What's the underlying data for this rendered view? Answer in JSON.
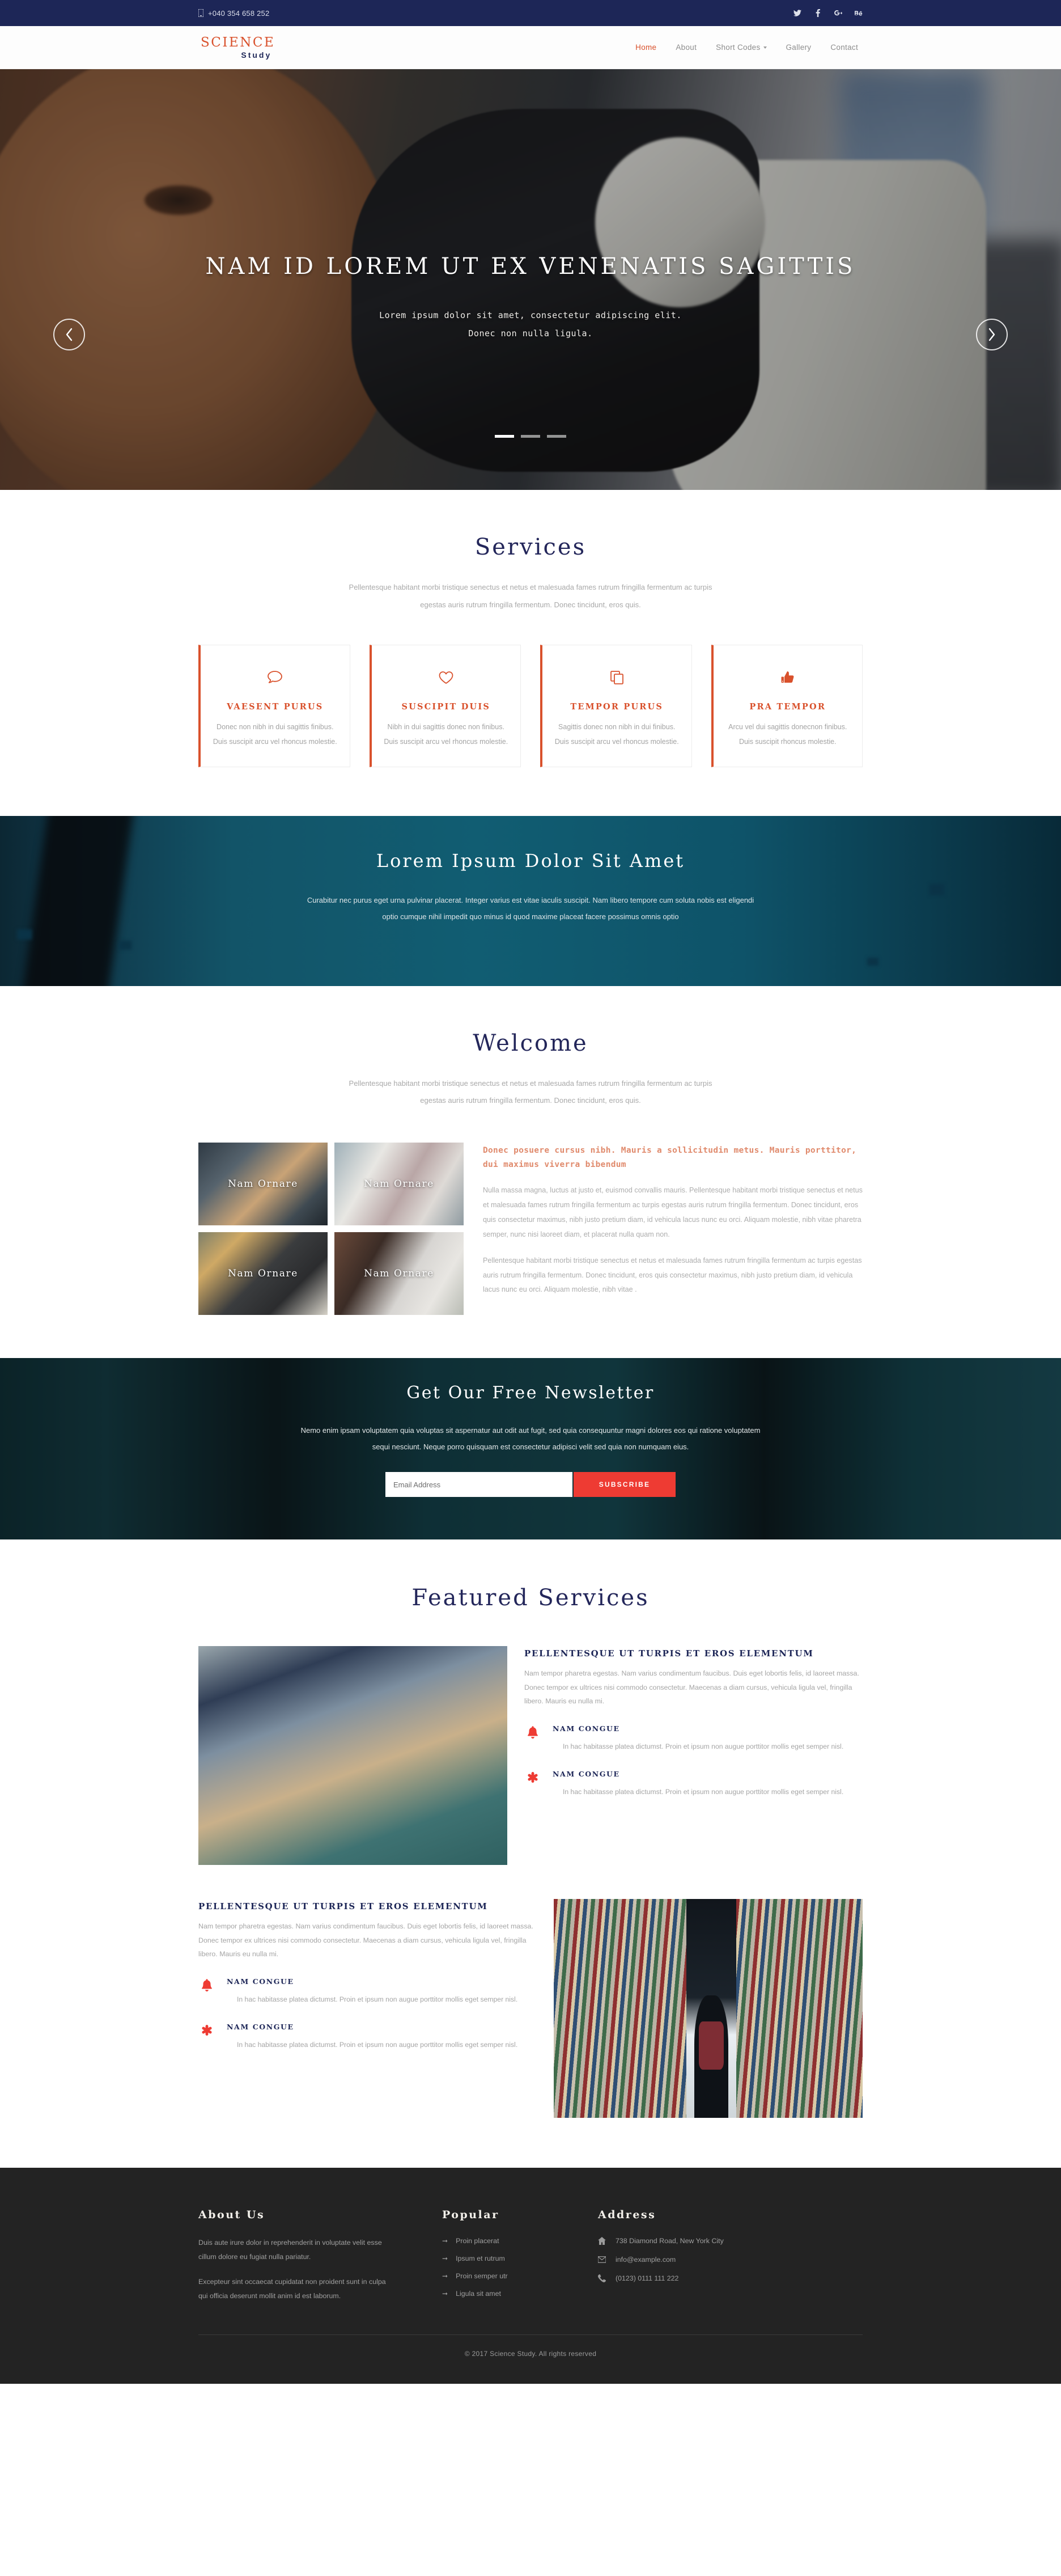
{
  "topbar": {
    "phone": "+040 354 658 252",
    "phone_icon": "phone-icon",
    "social": [
      {
        "name": "twitter-icon",
        "glyph": "t"
      },
      {
        "name": "facebook-icon",
        "glyph": "f"
      },
      {
        "name": "google-plus-icon",
        "glyph": "G+"
      },
      {
        "name": "behance-icon",
        "glyph": "Be"
      }
    ]
  },
  "header": {
    "logo_top": "SCIENCE",
    "logo_sub": "Study",
    "nav": [
      {
        "label": "Home",
        "active": true,
        "dropdown": false
      },
      {
        "label": "About",
        "active": false,
        "dropdown": false
      },
      {
        "label": "Short Codes",
        "active": false,
        "dropdown": true
      },
      {
        "label": "Gallery",
        "active": false,
        "dropdown": false
      },
      {
        "label": "Contact",
        "active": false,
        "dropdown": false
      }
    ]
  },
  "hero": {
    "title": "NAM ID LOREM UT EX VENENATIS SAGITTIS",
    "subtitle": "Lorem ipsum dolor sit amet, consectetur adipiscing elit. Donec non nulla ligula.",
    "prev_label": "‹",
    "next_label": "›",
    "slides": 3,
    "active_slide": 1
  },
  "services": {
    "title": "Services",
    "lead": "Pellentesque habitant morbi tristique senectus et netus et malesuada fames rutrum fringilla fermentum ac turpis egestas auris rutrum fringilla fermentum. Donec tincidunt, eros quis.",
    "cards": [
      {
        "icon": "comment-icon",
        "title": "VAESENT PURUS",
        "text": "Donec non nibh in dui sagittis finibus. Duis suscipit arcu vel rhoncus molestie."
      },
      {
        "icon": "heart-icon",
        "title": "SUSCIPIT DUIS",
        "text": "Nibh in dui sagittis donec non finibus. Duis suscipit arcu vel rhoncus molestie."
      },
      {
        "icon": "copy-icon",
        "title": "TEMPOR PURUS",
        "text": "Sagittis donec non nibh in dui finibus. Duis suscipit arcu vel rhoncus molestie."
      },
      {
        "icon": "thumbs-up-icon",
        "title": "PRA TEMPOR",
        "text": "Arcu vel dui sagittis donecnon finibus. Duis suscipit rhoncus molestie."
      }
    ]
  },
  "banner": {
    "title": "Lorem Ipsum Dolor Sit Amet",
    "text": "Curabitur nec purus eget urna pulvinar placerat. Integer varius est vitae iaculis suscipit. Nam libero tempore cum soluta nobis est eligendi optio cumque nihil impedit quo minus id quod maxime placeat facere possimus omnis optio"
  },
  "welcome": {
    "title": "Welcome",
    "lead": "Pellentesque habitant morbi tristique senectus et netus et malesuada fames rutrum fringilla fermentum ac turpis egestas auris rutrum fringilla fermentum. Donec tincidunt, eros quis.",
    "gallery": [
      {
        "label": "Nam Ornare"
      },
      {
        "label": "Nam Ornare"
      },
      {
        "label": "Nam Ornare"
      },
      {
        "label": "Nam Ornare"
      }
    ],
    "heading": "Donec posuere cursus nibh. Mauris a sollicitudin metus. Mauris porttitor, dui maximus viverra bibendum",
    "para1": "Nulla massa magna, luctus at justo et, euismod convallis mauris. Pellentesque habitant morbi tristique senectus et netus et malesuada fames rutrum fringilla fermentum ac turpis egestas auris rutrum fringilla fermentum. Donec tincidunt, eros quis consectetur maximus, nibh justo pretium diam, id vehicula lacus nunc eu orci. Aliquam molestie, nibh vitae pharetra semper, nunc nisi laoreet diam, et placerat nulla quam non.",
    "para2": "Pellentesque habitant morbi tristique senectus et netus et malesuada fames rutrum fringilla fermentum ac turpis egestas auris rutrum fringilla fermentum. Donec tincidunt, eros quis consectetur maximus, nibh justo pretium diam, id vehicula lacus nunc eu orci. Aliquam molestie, nibh vitae ."
  },
  "newsletter": {
    "title": "Get Our Free Newsletter",
    "text": "Nemo enim ipsam voluptatem quia voluptas sit aspernatur aut odit aut fugit, sed quia consequuntur magni dolores eos qui ratione voluptatem sequi nesciunt. Neque porro quisquam est consectetur adipisci velit sed quia non numquam eius.",
    "input_placeholder": "Email Address",
    "input_value": "",
    "button": "SUBSCRIBE"
  },
  "featured": {
    "title": "Featured Services",
    "blocks": [
      {
        "heading": "PELLENTESQUE UT TURPIS ET EROS ELEMENTUM",
        "text": "Nam tempor pharetra egestas. Nam varius condimentum faucibus. Duis eget lobortis felis, id laoreet massa. Donec tempor ex ultrices nisi commodo consectetur. Maecenas a diam cursus, vehicula ligula vel, fringilla libero. Mauris eu nulla mi.",
        "image": "students-on-couch-photo",
        "items": [
          {
            "icon": "bell-icon",
            "title": "NAM CONGUE",
            "text": "In hac habitasse platea dictumst. Proin et ipsum non augue porttitor mollis eget semper nisl."
          },
          {
            "icon": "asterisk-icon",
            "title": "NAM CONGUE",
            "text": "In hac habitasse platea dictumst. Proin et ipsum non augue porttitor mollis eget semper nisl."
          }
        ]
      },
      {
        "heading": "PELLENTESQUE UT TURPIS ET EROS ELEMENTUM",
        "text": "Nam tempor pharetra egestas. Nam varius condimentum faucibus. Duis eget lobortis felis, id laoreet massa. Donec tempor ex ultrices nisi commodo consectetur. Maecenas a diam cursus, vehicula ligula vel, fringilla libero. Mauris eu nulla mi.",
        "image": "library-aisle-photo",
        "items": [
          {
            "icon": "bell-icon",
            "title": "NAM CONGUE",
            "text": "In hac habitasse platea dictumst. Proin et ipsum non augue porttitor mollis eget semper nisl."
          },
          {
            "icon": "asterisk-icon",
            "title": "NAM CONGUE",
            "text": "In hac habitasse platea dictumst. Proin et ipsum non augue porttitor mollis eget semper nisl."
          }
        ]
      }
    ]
  },
  "footer": {
    "about": {
      "title": "About Us",
      "para1": "Duis aute irure dolor in reprehenderit in voluptate velit esse cillum dolore eu fugiat nulla pariatur.",
      "para2": "Excepteur sint occaecat cupidatat non proident sunt in culpa qui officia deserunt mollit anim id est laborum."
    },
    "popular": {
      "title": "Popular",
      "links": [
        "Proin placerat",
        "Ipsum et rutrum",
        "Proin semper utr",
        "Ligula sit amet"
      ]
    },
    "address": {
      "title": "Address",
      "items": [
        {
          "icon": "home-icon",
          "text": "738 Diamond Road, New York City"
        },
        {
          "icon": "envelope-icon",
          "text": "info@example.com"
        },
        {
          "icon": "phone-icon",
          "text": "(0123) 0111 111 222"
        }
      ]
    },
    "copyright": "© 2017 Science Study. All rights reserved"
  },
  "colors": {
    "navy": "#1d2657",
    "orange": "#d9512c",
    "red": "#ee3b33",
    "teal": "#11586d",
    "footer_bg": "#232323"
  }
}
